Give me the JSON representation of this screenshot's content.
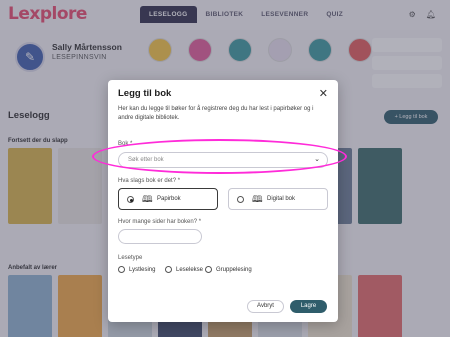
{
  "app": {
    "logo": "Lexplore",
    "nav": [
      "LESELOGG",
      "BIBLIOTEK",
      "LESEVENNER",
      "QUIZ"
    ],
    "top_icons": [
      "gear-icon",
      "bell-icon"
    ]
  },
  "profile": {
    "name": "Sally Mårtensson",
    "role": "LESEPINNSVIN"
  },
  "leselogg": {
    "title": "Leselogg",
    "add_button": "+ Legg til bok",
    "shelf1_title": "Fortsett der du slapp",
    "shelf2_title": "Anbefalt av lærer"
  },
  "modal": {
    "title": "Legg til bok",
    "close_icon": "close-icon",
    "description": "Her kan du legge til bøker for å registrere deg du har lest i papirbøker og i andre digitale bibliotek.",
    "book_label": "Bok *",
    "book_placeholder": "Søk etter bok",
    "kind_label": "Hva slags bok er det? *",
    "kind_options": [
      {
        "label": "Papirbok",
        "selected": true
      },
      {
        "label": "Digital bok",
        "selected": false
      }
    ],
    "pages_label": "Hvor mange sider har boken? *",
    "type_label": "Lesetype",
    "type_options": [
      "Lystlesing",
      "Leselekse",
      "Gruppelesing"
    ],
    "cancel": "Avbryt",
    "save": "Lagre"
  },
  "colors": {
    "primary": "#2f5d6b",
    "highlight": "#ff2bd9",
    "nav_active": "#2f2e4a"
  }
}
